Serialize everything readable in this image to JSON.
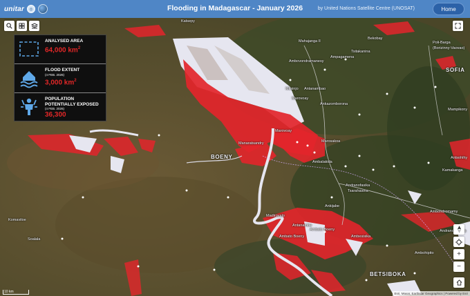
{
  "header": {
    "logo_text": "unitar",
    "title": "Flooding in Madagascar - January 2026",
    "byline": "by United Nations Satellite Centre (UNOSAT)",
    "home_label": "Home"
  },
  "stats": {
    "analysed": {
      "label": "ANALYSED AREA",
      "value": "64,000 km",
      "unit_sup": "2"
    },
    "flood": {
      "label": "FLOOD EXTENT",
      "date": "(4 FEB. 2026)",
      "value": "3,000 km",
      "unit_sup": "2"
    },
    "population": {
      "label_line1": "POPULATION",
      "label_line2": "POTENTIALLY EXPOSED",
      "date": "(4 FEB. 2026)",
      "value": "36,300"
    }
  },
  "tools": {
    "search_icon": "search-icon",
    "basemap_icon": "basemap-icon",
    "layers_icon": "layers-icon",
    "fullscreen_icon": "fullscreen-icon"
  },
  "nav": {
    "compass_icon": "compass-icon",
    "locate_icon": "locate-icon",
    "zoom_in": "+",
    "zoom_out": "−",
    "home_icon": "home-icon"
  },
  "map_labels": {
    "katsepy": "Katsepy",
    "mahajanga": "Mahajanga II",
    "bekobay": "Bekobay",
    "tsitakanina": "Tsitakanina",
    "ambovondramanesy": "Ambovondramanesy",
    "ampagamena": "Ampagamena",
    "poli_barga": "Poli-Barga",
    "borizinny": "(Borizinny-Vaovao)",
    "sofia": "SOFIA",
    "mitsinjo": "Mitsinjo",
    "antanambao": "Antanambao",
    "marovoay": "Marovoay",
    "ankazomborona": "Ankazomborona",
    "marovoay2": "Marovoay",
    "manaratsandry": "Manaratsandry",
    "marosakoa": "Marosakoa",
    "mampikony": "Mampikony",
    "boeny": "BOENY",
    "ambalakida": "Ambalakida",
    "tsarahasina": "Tsarahasina",
    "andranofasika": "Andranofasika",
    "ambondromamy": "Ambondromamy",
    "ankijabe": "Ankijabe",
    "madirovalo": "Madirovalo",
    "antanambe": "Antanambe",
    "ambato_boeny": "Ambato Boeny",
    "ambato_boeny2": "Ambato Boeny",
    "ambesisika": "Ambesisika",
    "karamvilo": "Komaviloe",
    "soalala": "Soalala",
    "andramanga": "Andranomalaza",
    "kamakanga": "Kamakanga",
    "betsiboka": "BETSIBOKA",
    "ambohipito": "Ambohipito",
    "aniaka": "Antsohihy"
  },
  "footer": {
    "scale_label": "10 km",
    "attribution": "Esri, Maxar, Earthstar Geographics | Powered by Esri"
  },
  "colors": {
    "header": "#4f86c6",
    "flood": "#e3252b",
    "panel": "#0f0f0f",
    "accent_value": "#e02727",
    "icon_blue": "#5fa8e8"
  }
}
